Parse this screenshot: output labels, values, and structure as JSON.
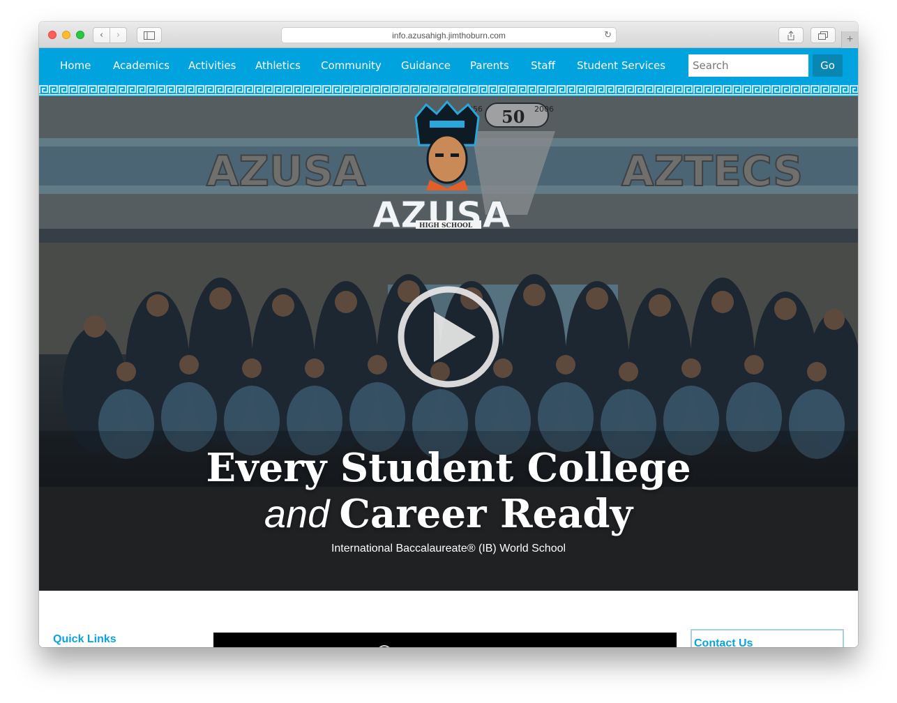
{
  "browser": {
    "url": "info.azusahigh.jimthoburn.com"
  },
  "nav": {
    "items": [
      "Home",
      "Academics",
      "Activities",
      "Athletics",
      "Community",
      "Guidance",
      "Parents",
      "Staff",
      "Student Services"
    ],
    "search_placeholder": "Search",
    "go_label": "Go"
  },
  "hero": {
    "logo_text": "AZUSA",
    "logo_subtext": "HIGH SCHOOL",
    "wall_sign_left": "AZUSA",
    "wall_sign_right": "AZTECS",
    "plaque_years_left": "1956",
    "plaque_years_right": "2006",
    "plaque_number": "50",
    "title_line1": "Every Student College",
    "title_and": "and",
    "title_line2": "Career Ready",
    "subtitle": "International Baccalaureate® (IB) World School"
  },
  "sidebar": {
    "quick_links_label": "Quick Links"
  },
  "contact": {
    "label": "Contact Us"
  },
  "colors": {
    "brand_blue": "#00a3dd",
    "go_button": "#0a86b2",
    "heading_blue": "#0aa3dd"
  }
}
